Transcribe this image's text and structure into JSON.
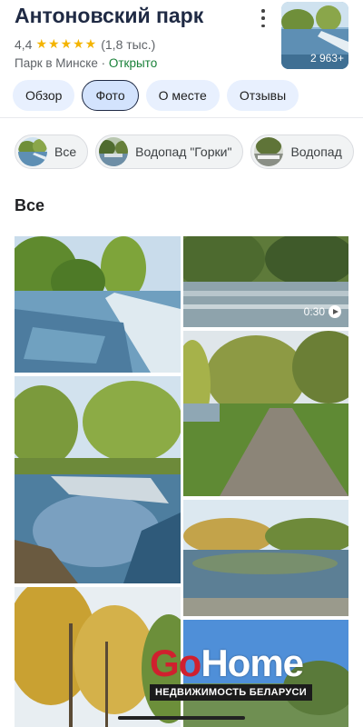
{
  "place": {
    "title": "Антоновский парк",
    "rating": "4,4",
    "stars": "★★★★★",
    "reviews_count": "(1,8 тыс.)",
    "category": "Парк в Минске",
    "separator": " · ",
    "status": "Открыто",
    "photo_count": "2 963+"
  },
  "tabs": [
    {
      "label": "Обзор",
      "active": false
    },
    {
      "label": "Фото",
      "active": true
    },
    {
      "label": "О месте",
      "active": false
    },
    {
      "label": "Отзывы",
      "active": false
    }
  ],
  "albums": [
    {
      "label": "Все"
    },
    {
      "label": "Водопад \"Горки\""
    },
    {
      "label": "Водопад"
    }
  ],
  "section_title": "Все",
  "video_duration": "0:30",
  "watermark": {
    "logo_part1": "Go",
    "logo_part2": "Home",
    "tagline": "НЕДВИЖИМОСТЬ БЕЛАРУСИ"
  },
  "colors": {
    "title": "#1f2a44",
    "star": "#f4b400",
    "open": "#188038",
    "tab_bg": "#e8f0fe",
    "watermark_red": "#d0202e"
  }
}
